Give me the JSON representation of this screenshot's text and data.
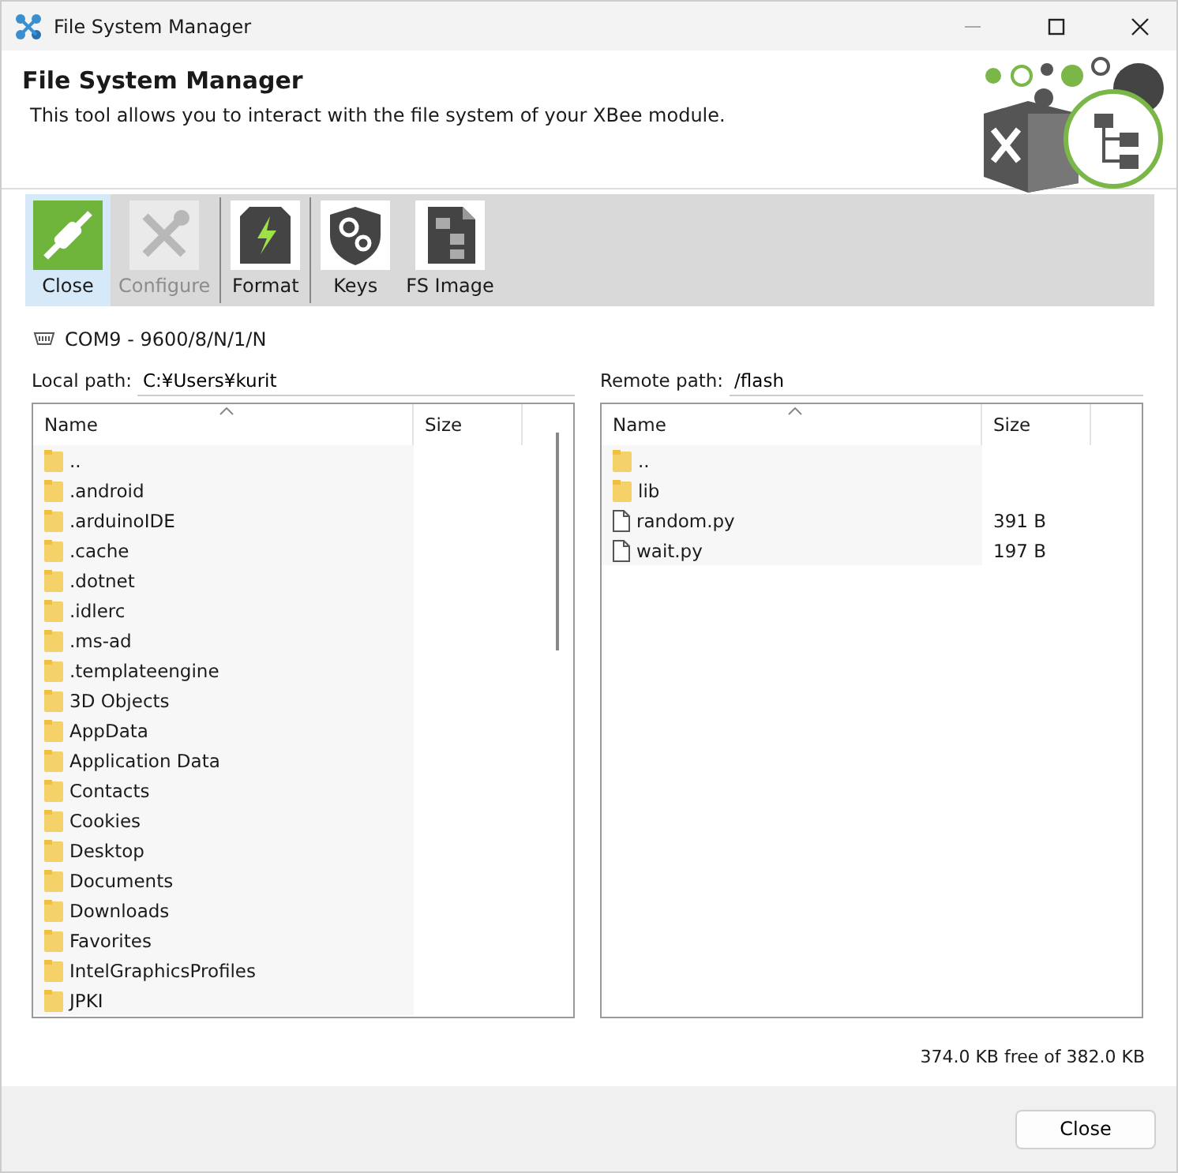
{
  "window": {
    "title": "File System Manager"
  },
  "header": {
    "title": "File System Manager",
    "description": "This tool allows you to interact with the file system of your XBee module."
  },
  "toolbar": [
    {
      "kind": "connect",
      "label": "Close",
      "selected": true,
      "disabled": false,
      "separator_before": false
    },
    {
      "kind": "configure",
      "label": "Configure",
      "selected": false,
      "disabled": true,
      "separator_before": false
    },
    {
      "kind": "format",
      "label": "Format",
      "selected": false,
      "disabled": false,
      "separator_before": true
    },
    {
      "kind": "keys",
      "label": "Keys",
      "selected": false,
      "disabled": false,
      "separator_before": true
    },
    {
      "kind": "fsimage",
      "label": "FS Image",
      "selected": false,
      "disabled": false,
      "separator_before": false
    }
  ],
  "connection": "COM9 - 9600/8/N/1/N",
  "local": {
    "path_label": "Local path:",
    "path": "C:¥Users¥kurit",
    "columns": [
      "Name",
      "Size"
    ],
    "files": [
      {
        "kind": "folder",
        "name": ".."
      },
      {
        "kind": "folder",
        "name": ".android"
      },
      {
        "kind": "folder",
        "name": ".arduinoIDE"
      },
      {
        "kind": "folder",
        "name": ".cache"
      },
      {
        "kind": "folder",
        "name": ".dotnet"
      },
      {
        "kind": "folder",
        "name": ".idlerc"
      },
      {
        "kind": "folder",
        "name": ".ms-ad"
      },
      {
        "kind": "folder",
        "name": ".templateengine"
      },
      {
        "kind": "folder",
        "name": "3D Objects"
      },
      {
        "kind": "folder",
        "name": "AppData"
      },
      {
        "kind": "folder",
        "name": "Application Data"
      },
      {
        "kind": "folder",
        "name": "Contacts"
      },
      {
        "kind": "folder",
        "name": "Cookies"
      },
      {
        "kind": "folder",
        "name": "Desktop"
      },
      {
        "kind": "folder",
        "name": "Documents"
      },
      {
        "kind": "folder",
        "name": "Downloads"
      },
      {
        "kind": "folder",
        "name": "Favorites"
      },
      {
        "kind": "folder",
        "name": "IntelGraphicsProfiles"
      },
      {
        "kind": "folder",
        "name": "JPKI"
      }
    ]
  },
  "remote": {
    "path_label": "Remote path:",
    "path": "/flash",
    "columns": [
      "Name",
      "Size"
    ],
    "files": [
      {
        "kind": "folder",
        "name": ".."
      },
      {
        "kind": "folder",
        "name": "lib"
      },
      {
        "kind": "file",
        "name": "random.py",
        "size": "391 B"
      },
      {
        "kind": "file",
        "name": "wait.py",
        "size": "197 B"
      }
    ]
  },
  "free_space": "374.0 KB free of 382.0 KB",
  "buttons": [
    "Close"
  ]
}
